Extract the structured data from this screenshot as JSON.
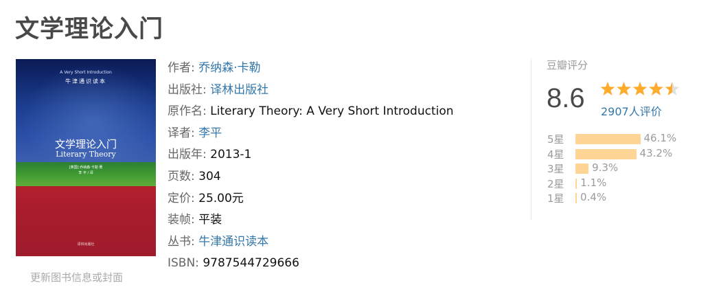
{
  "title": "文学理论入门",
  "cover": {
    "series_en": "A Very Short Introduction",
    "series_cn": "牛津通识读本",
    "title_cn": "文学理论入门",
    "title_en": "Literary Theory",
    "author_line": "[英国] 乔纳森·卡勒 著",
    "translator_line": "李 平 / 译",
    "publisher_line": "译林出版社",
    "colors": {
      "top": "#1b3d8f",
      "band": "#3f9a32",
      "bottom": "#a81c2d"
    }
  },
  "update_link": "更新图书信息或封面",
  "info": {
    "author_label": "作者:",
    "author": "乔纳森·卡勒",
    "publisher_label": "出版社:",
    "publisher": "译林出版社",
    "original_title_label": "原作名:",
    "original_title": "Literary Theory: A Very Short Introduction",
    "translator_label": "译者:",
    "translator": "李平",
    "pub_year_label": "出版年:",
    "pub_year": "2013-1",
    "pages_label": "页数:",
    "pages": "304",
    "price_label": "定价:",
    "price": "25.00元",
    "binding_label": "装帧:",
    "binding": "平装",
    "series_label": "丛书:",
    "series": "牛津通识读本",
    "isbn_label": "ISBN:",
    "isbn": "9787544729666"
  },
  "rating": {
    "title": "豆瓣评分",
    "score": "8.6",
    "stars_value": 4.5,
    "star_color": "#ffac2d",
    "count": "2907人评价",
    "distribution": [
      {
        "label": "5星",
        "pct": "46.1%",
        "value": 46.1
      },
      {
        "label": "4星",
        "pct": "43.2%",
        "value": 43.2
      },
      {
        "label": "3星",
        "pct": "9.3%",
        "value": 9.3
      },
      {
        "label": "2星",
        "pct": "1.1%",
        "value": 1.1
      },
      {
        "label": "1星",
        "pct": "0.4%",
        "value": 0.4
      }
    ]
  }
}
